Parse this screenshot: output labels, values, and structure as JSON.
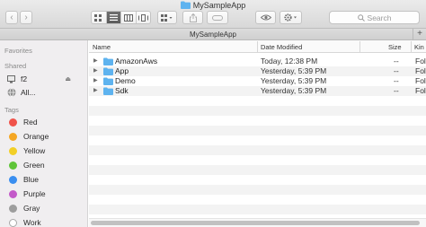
{
  "window": {
    "title": "MySampleApp",
    "search_placeholder": "Search",
    "icons": {
      "back": "chevron-left-icon",
      "forward": "chevron-right-icon",
      "share": "share-icon",
      "tag": "tag-icon",
      "quicklook": "eye-icon",
      "action": "gear-icon"
    }
  },
  "pathbar": {
    "label": "MySampleApp",
    "plus": "+"
  },
  "sidebar": {
    "favorites_label": "Favorites",
    "shared_label": "Shared",
    "shared_items": [
      {
        "label": "f2",
        "icon": "computer-icon"
      },
      {
        "label": "All...",
        "icon": "network-globe-icon"
      }
    ],
    "tags_label": "Tags",
    "tags": [
      {
        "label": "Red",
        "color": "#f0524a"
      },
      {
        "label": "Orange",
        "color": "#f5a623"
      },
      {
        "label": "Yellow",
        "color": "#f2cf27"
      },
      {
        "label": "Green",
        "color": "#5fc439"
      },
      {
        "label": "Blue",
        "color": "#3a8ef0"
      },
      {
        "label": "Purple",
        "color": "#c35ac9"
      },
      {
        "label": "Gray",
        "color": "#9d9d9d"
      },
      {
        "label": "Work",
        "color": "#ffffff"
      }
    ]
  },
  "list": {
    "columns": {
      "name": "Name",
      "date": "Date Modified",
      "size": "Size",
      "kind": "Kin"
    },
    "rows": [
      {
        "name": "AmazonAws",
        "date": "Today, 12:38 PM",
        "size": "--",
        "kind": "Fol"
      },
      {
        "name": "App",
        "date": "Yesterday, 5:39 PM",
        "size": "--",
        "kind": "Fol"
      },
      {
        "name": "Demo",
        "date": "Yesterday, 5:39 PM",
        "size": "--",
        "kind": "Fol"
      },
      {
        "name": "Sdk",
        "date": "Yesterday, 5:39 PM",
        "size": "--",
        "kind": "Fol"
      }
    ]
  },
  "colors": {
    "folder": "#5eb3ef",
    "accent": "#3a8ef0"
  }
}
